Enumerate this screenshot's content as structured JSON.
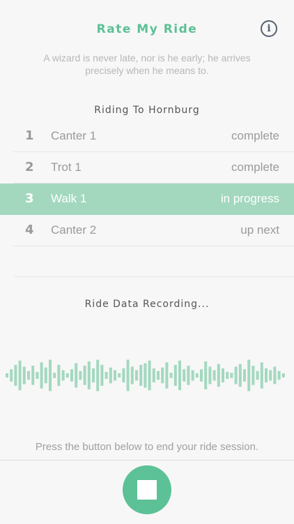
{
  "header": {
    "title": "Rate My Ride",
    "info_icon": "info-icon"
  },
  "quote": "A wizard is never late, nor is he early; he arrives precisely when he means to.",
  "route": {
    "title": "Riding To Hornburg"
  },
  "segments": [
    {
      "num": "1",
      "name": "Canter 1",
      "status": "complete"
    },
    {
      "num": "2",
      "name": "Trot 1",
      "status": "complete"
    },
    {
      "num": "3",
      "name": "Walk 1",
      "status": "in progress"
    },
    {
      "num": "4",
      "name": "Canter 2",
      "status": "up next"
    }
  ],
  "recording": {
    "label": "Ride Data Recording..."
  },
  "waveform": {
    "color": "#a3d8bf",
    "bars": [
      0.12,
      0.35,
      0.6,
      0.85,
      0.5,
      0.25,
      0.55,
      0.2,
      0.75,
      0.45,
      0.9,
      0.15,
      0.6,
      0.3,
      0.12,
      0.35,
      0.7,
      0.25,
      0.55,
      0.8,
      0.4,
      0.9,
      0.6,
      0.2,
      0.45,
      0.3,
      0.12,
      0.4,
      0.9,
      0.5,
      0.3,
      0.6,
      0.7,
      0.85,
      0.4,
      0.25,
      0.45,
      0.75,
      0.15,
      0.6,
      0.85,
      0.35,
      0.55,
      0.3,
      0.12,
      0.35,
      0.8,
      0.5,
      0.3,
      0.65,
      0.4,
      0.2,
      0.15,
      0.5,
      0.65,
      0.35,
      0.9,
      0.55,
      0.25,
      0.75,
      0.4,
      0.3,
      0.5,
      0.25,
      0.12
    ],
    "accent": "#5cc196"
  },
  "hint": "Press the button below to end your ride session.",
  "stop_button": {
    "icon": "stop-icon"
  }
}
